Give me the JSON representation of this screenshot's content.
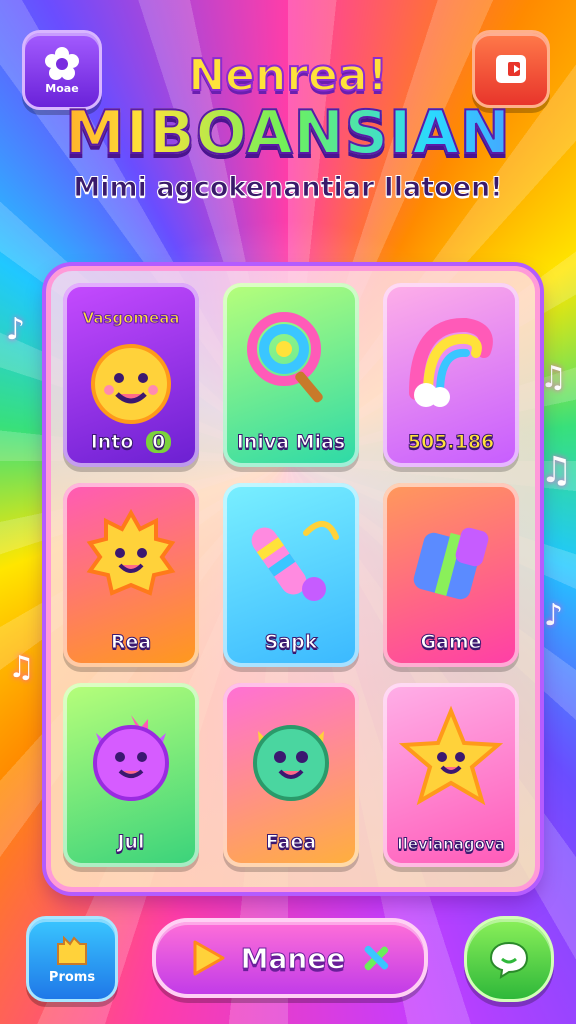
{
  "header": {
    "more_label": "Moae",
    "title_line1": "Nenrea!",
    "title_line2": "MIBOANSIAN",
    "subtitle": "Mimi agcokenantiar Ilatoen!"
  },
  "cards": [
    {
      "label": "Into",
      "badge": "0",
      "top_label": "Vasgomeaa"
    },
    {
      "label": "Iniva Mias"
    },
    {
      "label": "505.186"
    },
    {
      "label": "Rea"
    },
    {
      "label": "Sapk"
    },
    {
      "label": "Game"
    },
    {
      "label": "Jul"
    },
    {
      "label": "Faea"
    },
    {
      "label": "Ilevianagova"
    }
  ],
  "footer": {
    "promos_label": "Proms",
    "main_label": "Manee"
  },
  "icons": {
    "more": "flower-icon",
    "exit": "exit-door-icon",
    "promos": "castle-icon",
    "play": "play-icon",
    "main_extra": "crossed-tools-icon",
    "chat": "chat-bubble-icon"
  },
  "colors": {
    "accent_purple": "#8a2bd1",
    "title_yellow": "#ffe23a",
    "board_border": "#ff9ad8",
    "main_button": "#d44ce6",
    "chat_green": "#3fc23a"
  }
}
